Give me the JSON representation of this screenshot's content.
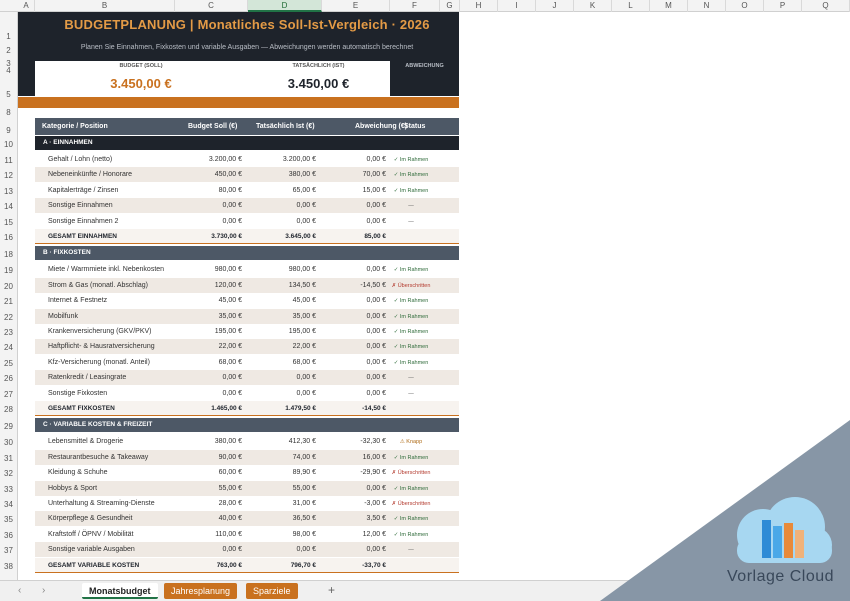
{
  "columns": [
    "A",
    "B",
    "C",
    "D",
    "E",
    "F",
    "G",
    "H",
    "I",
    "J",
    "K",
    "L",
    "M",
    "N",
    "O",
    "P",
    "Q"
  ],
  "selected_column": "D",
  "rows": [
    "1",
    "2",
    "3",
    "4",
    "5",
    "8",
    "9",
    "10",
    "11",
    "12",
    "13",
    "14",
    "15",
    "16",
    "18",
    "19",
    "20",
    "21",
    "22",
    "23",
    "24",
    "25",
    "26",
    "27",
    "28",
    "29",
    "30",
    "31",
    "32",
    "33",
    "34",
    "35",
    "36",
    "37",
    "38",
    "39"
  ],
  "header": {
    "title": "BUDGETPLANUNG  |  Monatliches Soll-Ist-Vergleich  ·  2026",
    "subtitle": "Planen Sie Einnahmen, Fixkosten und variable Ausgaben — Abweichungen werden automatisch berechnet"
  },
  "summary": {
    "budget_label": "BUDGET (SOLL)",
    "budget_value": "3.450,00 €",
    "actual_label": "TATSÄCHLICH (IST)",
    "actual_value": "3.450,00 €",
    "deviation_label": "ABWEICHUNG"
  },
  "table_header": {
    "category": "Kategorie / Position",
    "budget": "Budget Soll (€)",
    "actual": "Tatsächlich Ist (€)",
    "deviation": "Abweichung (€)",
    "status": "Status"
  },
  "sections": [
    {
      "title": "A · EINNAHMEN",
      "rows": [
        [
          "Gehalt / Lohn (netto)",
          "3.200,00 €",
          "3.200,00 €",
          "0,00 €",
          "✓ Im Rahmen"
        ],
        [
          "Nebeneinkünfte / Honorare",
          "450,00 €",
          "380,00 €",
          "70,00 €",
          "✓ Im Rahmen"
        ],
        [
          "Kapitalerträge / Zinsen",
          "80,00 €",
          "65,00 €",
          "15,00 €",
          "✓ Im Rahmen"
        ],
        [
          "Sonstige Einnahmen",
          "0,00 €",
          "0,00 €",
          "0,00 €",
          "—"
        ],
        [
          "Sonstige Einnahmen 2",
          "0,00 €",
          "0,00 €",
          "0,00 €",
          "—"
        ]
      ],
      "total": [
        "GESAMT EINNAHMEN",
        "3.730,00 €",
        "3.645,00 €",
        "85,00 €",
        ""
      ]
    },
    {
      "title": "B · FIXKOSTEN",
      "rows": [
        [
          "Miete / Warmmiete inkl. Nebenkosten",
          "980,00 €",
          "980,00 €",
          "0,00 €",
          "✓ Im Rahmen"
        ],
        [
          "Strom & Gas (monatl. Abschlag)",
          "120,00 €",
          "134,50 €",
          "-14,50 €",
          "✗ Überschritten"
        ],
        [
          "Internet & Festnetz",
          "45,00 €",
          "45,00 €",
          "0,00 €",
          "✓ Im Rahmen"
        ],
        [
          "Mobilfunk",
          "35,00 €",
          "35,00 €",
          "0,00 €",
          "✓ Im Rahmen"
        ],
        [
          "Krankenversicherung (GKV/PKV)",
          "195,00 €",
          "195,00 €",
          "0,00 €",
          "✓ Im Rahmen"
        ],
        [
          "Haftpflicht- & Hausratversicherung",
          "22,00 €",
          "22,00 €",
          "0,00 €",
          "✓ Im Rahmen"
        ],
        [
          "Kfz-Versicherung (monatl. Anteil)",
          "68,00 €",
          "68,00 €",
          "0,00 €",
          "✓ Im Rahmen"
        ],
        [
          "Ratenkredit / Leasingrate",
          "0,00 €",
          "0,00 €",
          "0,00 €",
          "—"
        ],
        [
          "Sonstige Fixkosten",
          "0,00 €",
          "0,00 €",
          "0,00 €",
          "—"
        ]
      ],
      "total": [
        "GESAMT FIXKOSTEN",
        "1.465,00 €",
        "1.479,50 €",
        "-14,50 €",
        ""
      ]
    },
    {
      "title": "C · VARIABLE KOSTEN & FREIZEIT",
      "rows": [
        [
          "Lebensmittel & Drogerie",
          "380,00 €",
          "412,30 €",
          "-32,30 €",
          "⚠ Knapp"
        ],
        [
          "Restaurantbesuche & Takeaway",
          "90,00 €",
          "74,00 €",
          "16,00 €",
          "✓ Im Rahmen"
        ],
        [
          "Kleidung & Schuhe",
          "60,00 €",
          "89,90 €",
          "-29,90 €",
          "✗ Überschritten"
        ],
        [
          "Hobbys & Sport",
          "55,00 €",
          "55,00 €",
          "0,00 €",
          "✓ Im Rahmen"
        ],
        [
          "Unterhaltung & Streaming-Dienste",
          "28,00 €",
          "31,00 €",
          "-3,00 €",
          "✗ Überschritten"
        ],
        [
          "Körperpflege & Gesundheit",
          "40,00 €",
          "36,50 €",
          "3,50 €",
          "✓ Im Rahmen"
        ],
        [
          "Kraftstoff / ÖPNV / Mobilität",
          "110,00 €",
          "98,00 €",
          "12,00 €",
          "✓ Im Rahmen"
        ],
        [
          "Sonstige variable Ausgaben",
          "0,00 €",
          "0,00 €",
          "0,00 €",
          "—"
        ]
      ],
      "total": [
        "GESAMT VARIABLE KOSTEN",
        "763,00 €",
        "796,70 €",
        "-33,70 €",
        ""
      ]
    }
  ],
  "tabs": [
    "Monatsbudget",
    "Jahresplanung",
    "Sparziele"
  ],
  "add_tab": "+",
  "brand": {
    "word1": "Vorlage",
    "word2": "Cloud"
  },
  "colors": {
    "dark": "#1e232b",
    "accent": "#c9711f",
    "header": "#4d5866",
    "stripe": "#efe9e3"
  }
}
